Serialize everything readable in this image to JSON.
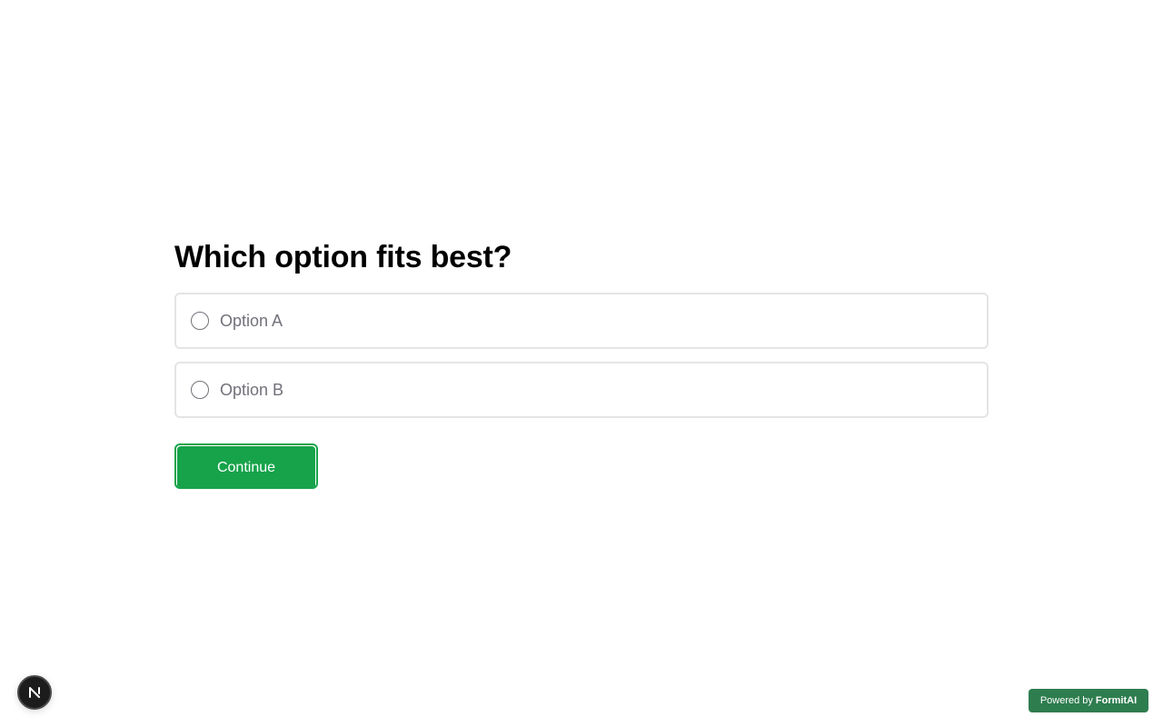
{
  "question": {
    "title": "Which option fits best?"
  },
  "options": [
    {
      "label": "Option A",
      "selected": false
    },
    {
      "label": "Option B",
      "selected": false
    }
  ],
  "actions": {
    "continue_label": "Continue"
  },
  "dev_badge": {
    "letter": "N",
    "icon": "nextjs-icon"
  },
  "footer": {
    "powered_prefix": "Powered by",
    "powered_brand": "FormitAI"
  },
  "colors": {
    "accent": "#16a34a",
    "badge": "#2e7d4f"
  }
}
